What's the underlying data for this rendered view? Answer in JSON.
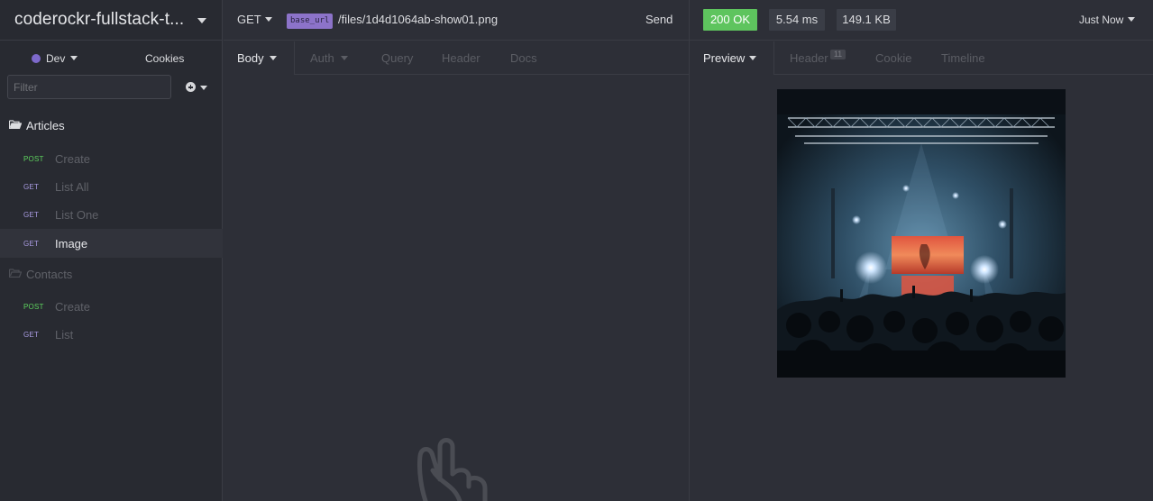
{
  "workspace": {
    "title": "coderockr-fullstack-t..."
  },
  "environment": {
    "name": "Dev",
    "color": "#7d69cb"
  },
  "cookies_label": "Cookies",
  "filter": {
    "placeholder": "Filter",
    "value": ""
  },
  "sidebar": {
    "folders": [
      {
        "name": "Articles",
        "open": true,
        "requests": [
          {
            "method": "POST",
            "name": "Create",
            "active": false
          },
          {
            "method": "GET",
            "name": "List All",
            "active": false
          },
          {
            "method": "GET",
            "name": "List One",
            "active": false
          },
          {
            "method": "GET",
            "name": "Image",
            "active": true
          }
        ]
      },
      {
        "name": "Contacts",
        "open": true,
        "requests": [
          {
            "method": "POST",
            "name": "Create",
            "active": false
          },
          {
            "method": "GET",
            "name": "List",
            "active": false
          }
        ]
      }
    ]
  },
  "request": {
    "method": "GET",
    "url_variable": "base_url",
    "url_path": "/files/1d4d1064ab-show01.png",
    "send_label": "Send",
    "tabs": [
      "Body",
      "Auth",
      "Query",
      "Header",
      "Docs"
    ],
    "active_tab": "Body"
  },
  "response": {
    "status": "200 OK",
    "status_color": "#5ec45e",
    "time": "5.54 ms",
    "size": "149.1 KB",
    "history_label": "Just Now",
    "tabs": [
      "Preview",
      "Header",
      "Cookie",
      "Timeline"
    ],
    "header_count": "11",
    "active_tab": "Preview"
  },
  "icons": {
    "workspace_menu": "chevron-down-icon",
    "add": "plus-circle-icon",
    "folder_open": "folder-open-icon",
    "folder_closed": "folder-icon",
    "empty_state": "peace-hand-icon"
  }
}
